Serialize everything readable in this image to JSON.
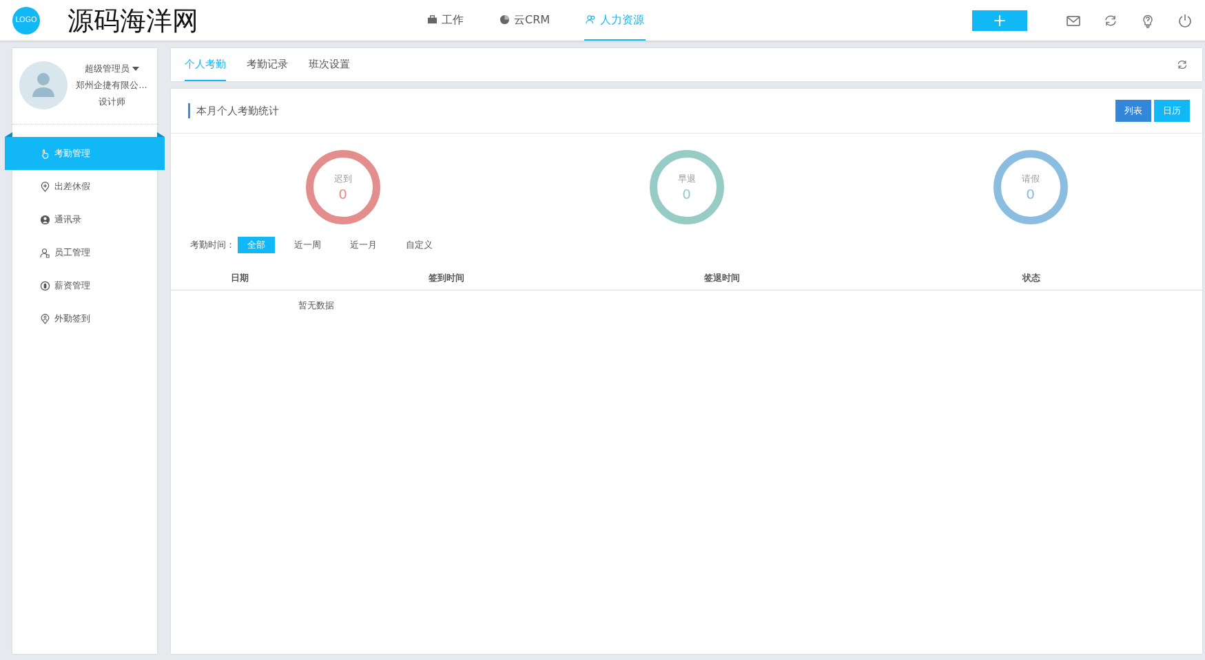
{
  "header": {
    "logo": "LOGO",
    "site_title": "源码海洋网",
    "nav": [
      {
        "label": "工作",
        "selected": false
      },
      {
        "label": "云CRM",
        "selected": false
      },
      {
        "label": "人力资源",
        "selected": true
      }
    ],
    "add_button": "+"
  },
  "profile": {
    "role": "超级管理员",
    "company": "郑州企捷有限公...",
    "position": "设计师"
  },
  "sidebar": {
    "items": [
      {
        "label": "考勤管理",
        "selected": true
      },
      {
        "label": "出差休假",
        "selected": false
      },
      {
        "label": "通讯录",
        "selected": false
      },
      {
        "label": "员工管理",
        "selected": false
      },
      {
        "label": "薪资管理",
        "selected": false
      },
      {
        "label": "外勤签到",
        "selected": false
      }
    ]
  },
  "tabs": [
    {
      "label": "个人考勤",
      "selected": true
    },
    {
      "label": "考勤记录",
      "selected": false
    },
    {
      "label": "班次设置",
      "selected": false
    }
  ],
  "stats_panel": {
    "title": "本月个人考勤统计",
    "view_buttons": [
      {
        "label": "列表",
        "selected": true
      },
      {
        "label": "日历",
        "selected": false
      }
    ],
    "stats": [
      {
        "label": "迟到",
        "value": "0",
        "color": "#e38d8d"
      },
      {
        "label": "早退",
        "value": "0",
        "color": "#96cbc6"
      },
      {
        "label": "请假",
        "value": "0",
        "color": "#8bbde0"
      }
    ],
    "filter": {
      "label": "考勤时间：",
      "options": [
        {
          "label": "全部",
          "selected": true
        },
        {
          "label": "近一周",
          "selected": false
        },
        {
          "label": "近一月",
          "selected": false
        },
        {
          "label": "自定义",
          "selected": false
        }
      ]
    },
    "table": {
      "columns": [
        "日期",
        "签到时间",
        "签退时间",
        "状态"
      ],
      "empty_text": "暂无数据"
    }
  }
}
